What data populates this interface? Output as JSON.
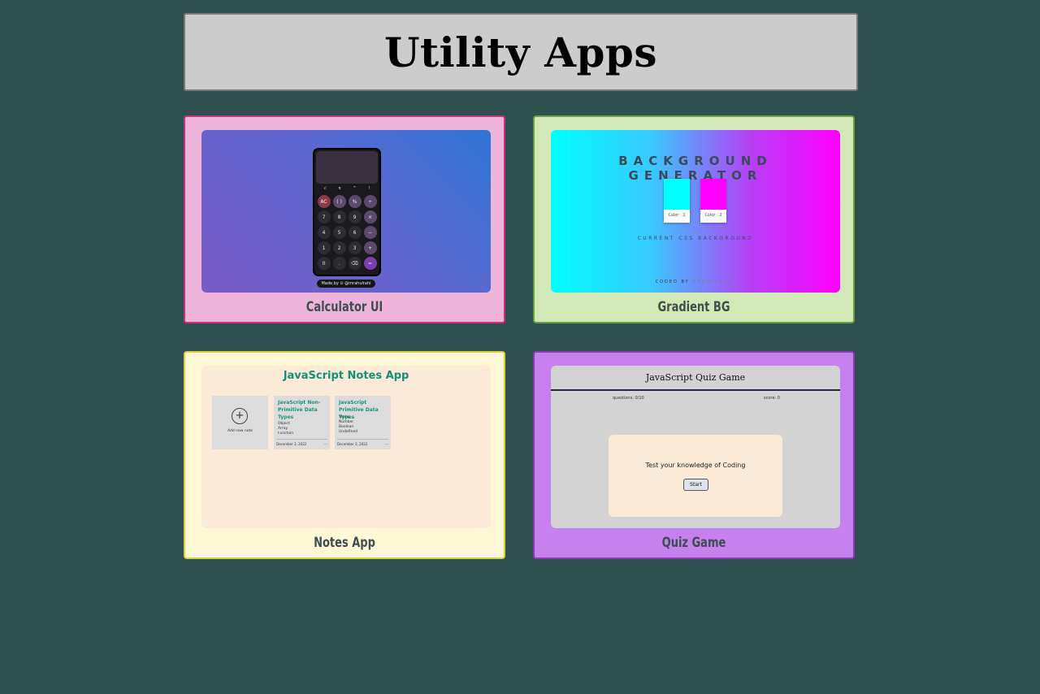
{
  "page": {
    "title": "Utility Apps"
  },
  "cards": [
    {
      "label": "Calculator UI",
      "preview": {
        "fn_row": [
          "√",
          "π",
          "^",
          "!"
        ],
        "keys": [
          "AC",
          "( )",
          "%",
          "÷",
          "7",
          "8",
          "9",
          "×",
          "4",
          "5",
          "6",
          "−",
          "1",
          "2",
          "3",
          "+",
          "0",
          ".",
          "⌫",
          "="
        ],
        "made_by": "Made by ⊙ @mrahulrahi"
      }
    },
    {
      "label": "Gradient BG",
      "preview": {
        "title": "BACKGROUND GENERATOR",
        "color1_label": "Color : 1",
        "color2_label": "Color : 2",
        "color1": "#00ffff",
        "color2": "#ff00ff",
        "current_label": "CURRENT CSS BACKGROUND",
        "coded_by": "CODED BY",
        "author": "MRAHULRAHI"
      }
    },
    {
      "label": "Notes App",
      "preview": {
        "title": "JavaScript Notes App",
        "add_note": "Add new note",
        "notes": [
          {
            "title": "JavaScript Non-Primitive Data Types",
            "items": [
              "Object",
              "Array",
              "Function"
            ],
            "date": "December 3, 2022",
            "menu": "···"
          },
          {
            "title": "JavaScript Primitive Data Types",
            "items": [
              "String",
              "Number",
              "Boolean",
              "Undefined"
            ],
            "date": "December 3, 2022",
            "menu": "···"
          }
        ]
      }
    },
    {
      "label": "Quiz Game",
      "preview": {
        "title": "JavaScript Quiz Game",
        "questions": "questions: 0/10",
        "score": "score: 0",
        "prompt": "Test your knowledge of Coding",
        "start": "Start"
      }
    }
  ],
  "colors": {
    "background": "#2e4f4d",
    "calc_card": "#efb4d9",
    "gradient_card": "#d3e8b7",
    "notes_card": "#fef8d6",
    "quiz_card": "#c681ef"
  }
}
